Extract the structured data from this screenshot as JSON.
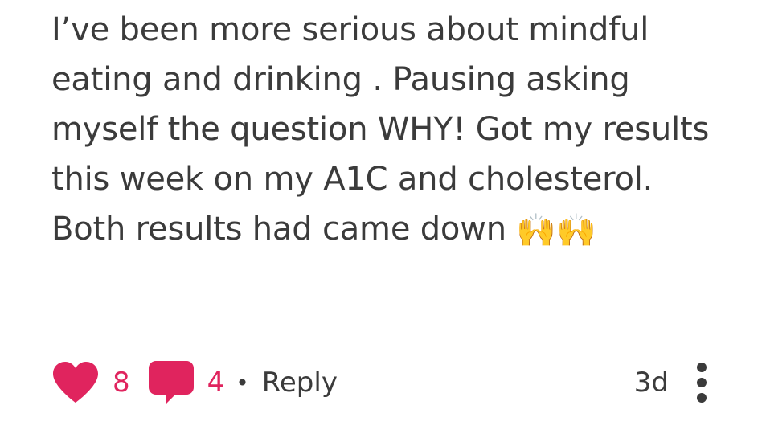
{
  "post": {
    "text": "I’ve been more serious about mindful eating and drinking . Pausing asking myself the question WHY! Got my results this week on my A1C and cholesterol. Both results had came down",
    "emoji": "🙌🙌"
  },
  "actions": {
    "likes": "8",
    "comments": "4",
    "separator": "•",
    "reply_label": "Reply",
    "time": "3d"
  },
  "icons": {
    "like": "heart-icon",
    "comment": "comment-icon",
    "more": "more-vertical-icon"
  },
  "colors": {
    "accent": "#e0245e",
    "text": "#3b3b3b"
  }
}
